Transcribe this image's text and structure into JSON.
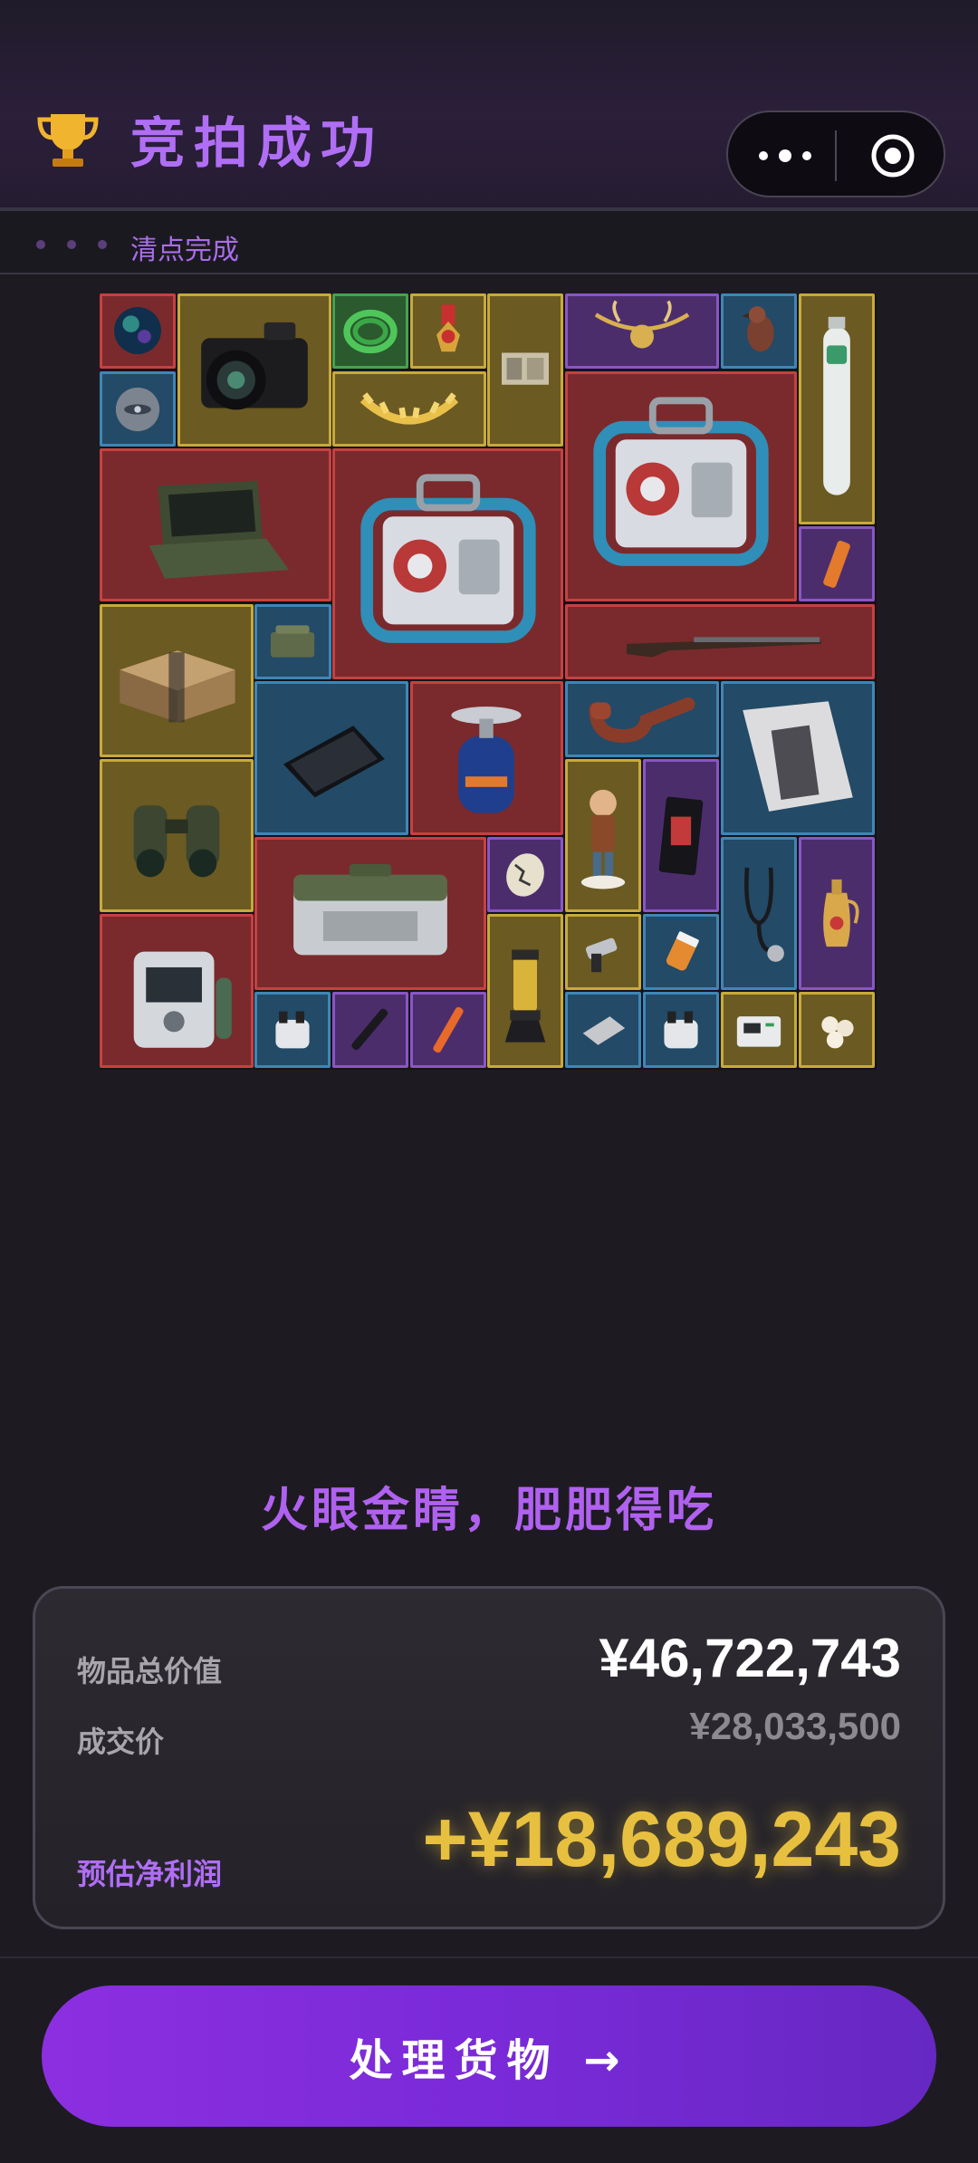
{
  "header": {
    "title": "竞拍成功",
    "trophy_icon": "trophy-icon",
    "more_icon": "more-dots-icon",
    "close_icon": "target-circle-icon"
  },
  "subbar": {
    "status": "清点完成"
  },
  "grid": {
    "items": [
      {
        "name": "orb",
        "icon": "orb-icon",
        "color": "red"
      },
      {
        "name": "camera",
        "icon": "camera-icon",
        "color": "gold"
      },
      {
        "name": "green-cable",
        "icon": "cable-icon",
        "color": "green"
      },
      {
        "name": "medal",
        "icon": "medal-icon",
        "color": "gold"
      },
      {
        "name": "banknote",
        "icon": "banknote-icon",
        "color": "gold"
      },
      {
        "name": "horn-necklace",
        "icon": "necklace-icon",
        "color": "purple"
      },
      {
        "name": "bird-figurine",
        "icon": "bird-icon",
        "color": "blue"
      },
      {
        "name": "oxygen-tank",
        "icon": "tank-icon",
        "color": "gold"
      },
      {
        "name": "drone-disc",
        "icon": "disc-icon",
        "color": "blue"
      },
      {
        "name": "laurel-crown",
        "icon": "laurel-icon",
        "color": "gold"
      },
      {
        "name": "reactor-1",
        "icon": "reactor-icon",
        "color": "red"
      },
      {
        "name": "reactor-2",
        "icon": "reactor-icon",
        "color": "red"
      },
      {
        "name": "rugged-laptop",
        "icon": "laptop-icon",
        "color": "red"
      },
      {
        "name": "scroll",
        "icon": "scroll-icon",
        "color": "purple"
      },
      {
        "name": "flintlock-rifle",
        "icon": "rifle-icon",
        "color": "red"
      },
      {
        "name": "ammo-crate",
        "icon": "crate-icon",
        "color": "gold"
      },
      {
        "name": "ammo-can",
        "icon": "ammo-can-icon",
        "color": "blue"
      },
      {
        "name": "tablet",
        "icon": "tablet-icon",
        "color": "blue"
      },
      {
        "name": "gas-stove",
        "icon": "stove-icon",
        "color": "red"
      },
      {
        "name": "pipe",
        "icon": "pipe-icon",
        "color": "blue"
      },
      {
        "name": "magazine",
        "icon": "magazine-icon",
        "color": "blue"
      },
      {
        "name": "binoculars",
        "icon": "binoculars-icon",
        "color": "gold"
      },
      {
        "name": "figurine",
        "icon": "figurine-icon",
        "color": "gold"
      },
      {
        "name": "black-pouch",
        "icon": "pouch-icon",
        "color": "purple"
      },
      {
        "name": "military-case",
        "icon": "case-icon",
        "color": "red"
      },
      {
        "name": "egg",
        "icon": "egg-icon",
        "color": "purple"
      },
      {
        "name": "stethoscope",
        "icon": "stethoscope-icon",
        "color": "blue"
      },
      {
        "name": "golden-ewer",
        "icon": "ewer-icon",
        "color": "purple"
      },
      {
        "name": "generator",
        "icon": "generator-icon",
        "color": "red"
      },
      {
        "name": "lamp",
        "icon": "lamp-icon",
        "color": "gold"
      },
      {
        "name": "robot-arm",
        "icon": "robot-arm-icon",
        "color": "gold"
      },
      {
        "name": "pill-bottle",
        "icon": "pill-icon",
        "color": "blue"
      },
      {
        "name": "part-a",
        "icon": "part-icon",
        "color": "blue"
      },
      {
        "name": "pen",
        "icon": "pen-icon",
        "color": "purple"
      },
      {
        "name": "firework",
        "icon": "firework-icon",
        "color": "purple"
      },
      {
        "name": "metal-plate",
        "icon": "plate-icon",
        "color": "blue"
      },
      {
        "name": "part-b",
        "icon": "part-icon",
        "color": "blue"
      },
      {
        "name": "controller",
        "icon": "controller-icon",
        "color": "gold"
      },
      {
        "name": "pearls",
        "icon": "pearls-icon",
        "color": "gold"
      }
    ]
  },
  "slogan": "火眼金睛，肥肥得吃",
  "summary": {
    "total_label": "物品总价值",
    "total_value": "¥46,722,743",
    "deal_label": "成交价",
    "deal_value": "¥28,033,500",
    "profit_label": "预估净利润",
    "profit_value": "+¥18,689,243"
  },
  "action": {
    "label": "处理货物 →"
  },
  "colors": {
    "accent_purple": "#b06ef5",
    "profit_gold": "#e8c040",
    "button_purple": "#8c2fe0"
  }
}
